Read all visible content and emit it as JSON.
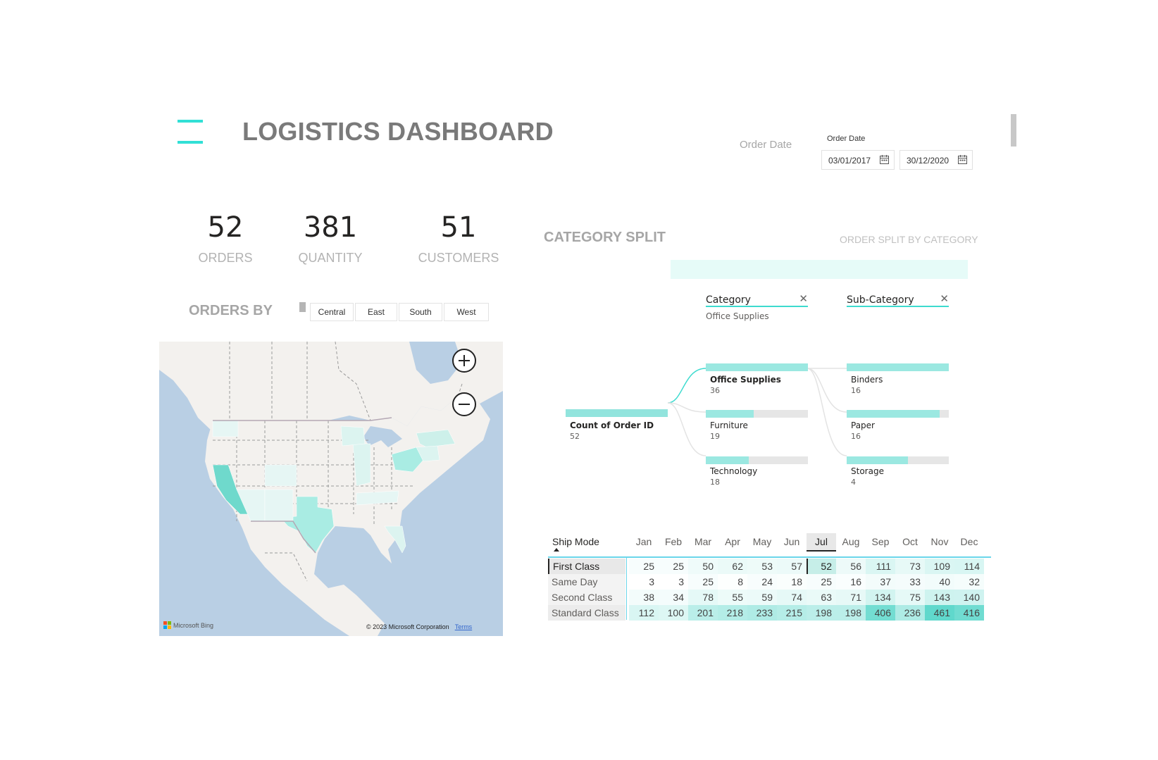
{
  "header": {
    "title": "LOGISTICS DASHBOARD",
    "order_date_caption": "Order Date",
    "order_date_label": "Order Date",
    "start_date": "03/01/2017",
    "end_date": "30/12/2020"
  },
  "kpis": [
    {
      "value": "52",
      "label": "ORDERS"
    },
    {
      "value": "381",
      "label": "QUANTITY"
    },
    {
      "value": "51",
      "label": "CUSTOMERS"
    }
  ],
  "orders_by": {
    "title": "ORDERS BY",
    "regions": [
      "Central",
      "East",
      "South",
      "West"
    ]
  },
  "map": {
    "provider": "Microsoft Bing",
    "copyright": "© 2023 Microsoft Corporation",
    "terms": "Terms"
  },
  "decomposition": {
    "title": "CATEGORY SPLIT",
    "subtitle": "ORDER SPLIT BY CATEGORY",
    "root": {
      "label": "Count of Order ID",
      "value": "52"
    },
    "levels": [
      {
        "name": "Category",
        "selected": "Office Supplies"
      },
      {
        "name": "Sub-Category",
        "selected": ""
      }
    ],
    "categories": [
      {
        "label": "Office Supplies",
        "value": "36",
        "share": 1.0
      },
      {
        "label": "Furniture",
        "value": "19",
        "share": 0.47
      },
      {
        "label": "Technology",
        "value": "18",
        "share": 0.42
      }
    ],
    "subcategories": [
      {
        "label": "Binders",
        "value": "16",
        "share": 1.0
      },
      {
        "label": "Paper",
        "value": "16",
        "share": 0.91
      },
      {
        "label": "Storage",
        "value": "4",
        "share": 0.6
      }
    ]
  },
  "matrix": {
    "row_header": "Ship Mode",
    "columns": [
      "Jan",
      "Feb",
      "Mar",
      "Apr",
      "May",
      "Jun",
      "Jul",
      "Aug",
      "Sep",
      "Oct",
      "Nov",
      "Dec"
    ],
    "rows": [
      {
        "label": "First Class",
        "values": [
          "25",
          "25",
          "50",
          "62",
          "53",
          "57",
          "52",
          "56",
          "111",
          "73",
          "109",
          "114"
        ]
      },
      {
        "label": "Same Day",
        "values": [
          "3",
          "3",
          "25",
          "8",
          "24",
          "18",
          "25",
          "16",
          "37",
          "33",
          "40",
          "32"
        ]
      },
      {
        "label": "Second Class",
        "values": [
          "38",
          "34",
          "78",
          "55",
          "59",
          "74",
          "63",
          "71",
          "134",
          "75",
          "143",
          "140"
        ]
      },
      {
        "label": "Standard Class",
        "values": [
          "112",
          "100",
          "201",
          "218",
          "233",
          "215",
          "198",
          "198",
          "406",
          "236",
          "461",
          "416"
        ]
      }
    ]
  }
}
